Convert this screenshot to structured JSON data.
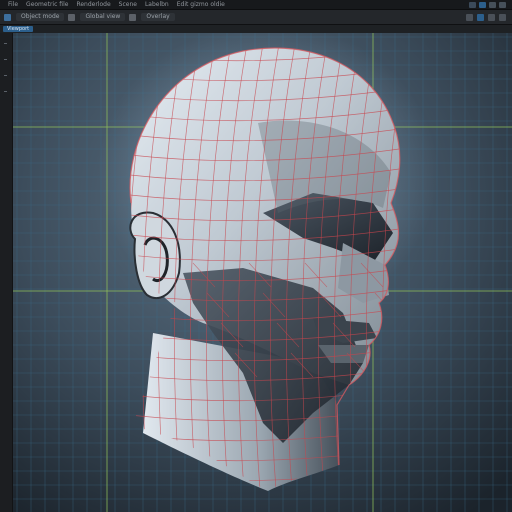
{
  "menu": {
    "items": [
      "File",
      "Geometric file",
      "Renderlode",
      "Scene",
      "Labelbn",
      "Edit gizmo oldie"
    ]
  },
  "toolbar": {
    "editor_label": "Object mode",
    "view_label": "Global view",
    "overlay_label": "Overlay"
  },
  "subtoolbar": {
    "tab_label": "Viewport"
  },
  "colors": {
    "grid_minor": "#3b6e8c",
    "grid_major": "#8fbf5a",
    "wireframe": "#c8464d",
    "accent": "#2c5f8c"
  },
  "icons": [
    "app-icon",
    "viewport-icon",
    "globe-icon",
    "search-icon",
    "shading-icon",
    "grid-icon",
    "close-icon"
  ]
}
